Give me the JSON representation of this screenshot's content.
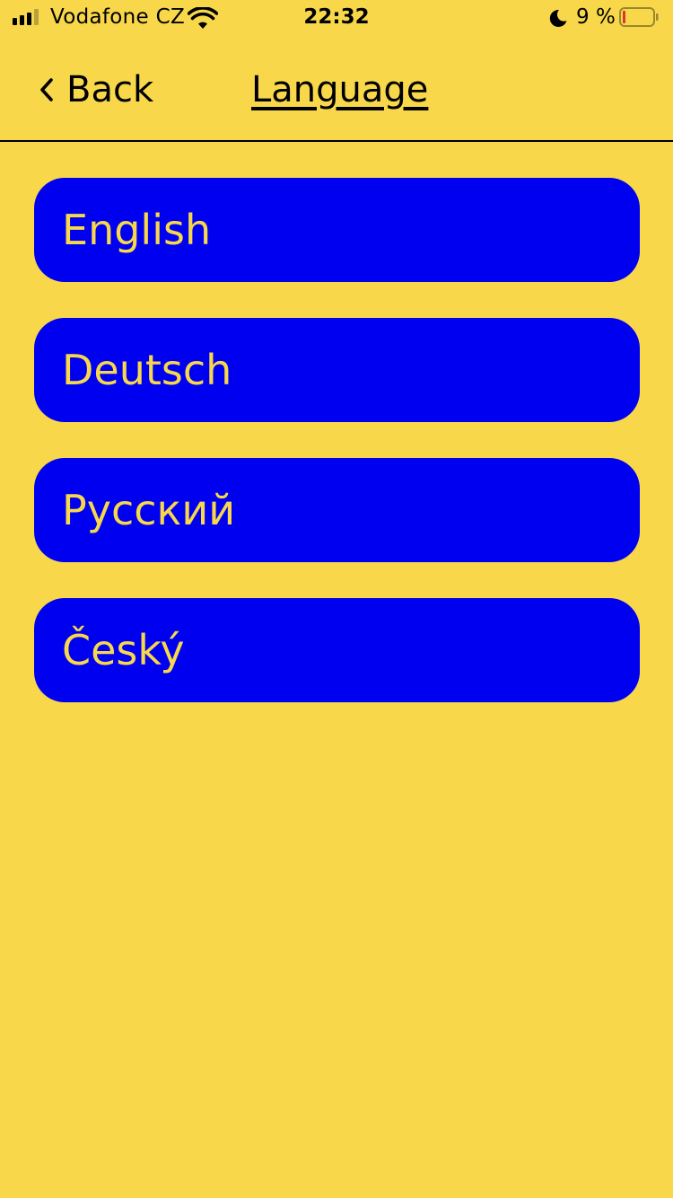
{
  "status_bar": {
    "carrier": "Vodafone CZ",
    "time": "22:32",
    "battery_percent": "9 %",
    "signal_bars_filled": 3,
    "signal_bars_total": 4,
    "battery_level": 0.09,
    "icons": [
      "signal-icon",
      "wifi-icon",
      "moon-icon",
      "battery-icon"
    ]
  },
  "nav": {
    "back_label": "Back",
    "title": "Language",
    "back_icon": "chevron-left-icon"
  },
  "languages": [
    {
      "label": "English"
    },
    {
      "label": "Deutsch"
    },
    {
      "label": "Русский"
    },
    {
      "label": "Český"
    }
  ],
  "colors": {
    "background": "#F8D84A",
    "button": "#0000F0",
    "button_text": "#F8D84A",
    "battery_low": "#E0352B"
  }
}
